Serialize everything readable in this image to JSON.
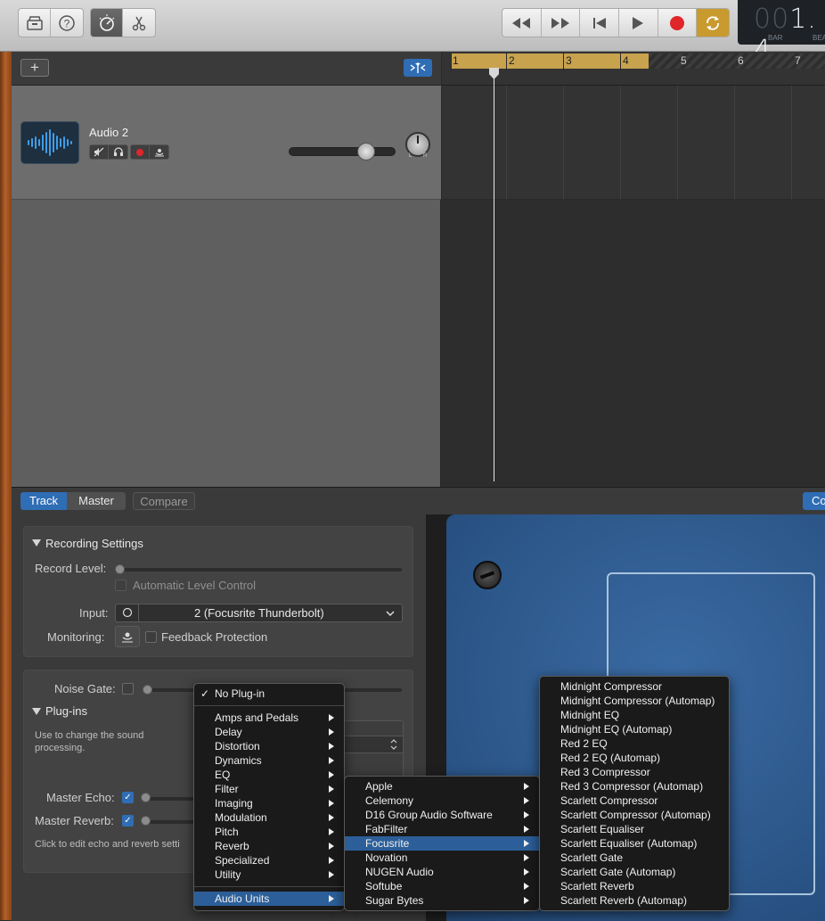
{
  "toolbar": {
    "lcd_digits_dim": "00",
    "lcd_digits": "1. 4",
    "lcd_unit_bar": "BAR",
    "lcd_unit_beat": "BEA"
  },
  "tracks": {
    "track_name": "Audio 2",
    "pan_left": "L",
    "pan_right": "R"
  },
  "ruler": {
    "bars": [
      "1",
      "2",
      "3",
      "4",
      "5",
      "6",
      "7"
    ]
  },
  "editor": {
    "tabs": {
      "track": "Track",
      "master": "Master",
      "compare": "Compare",
      "co": "Co"
    },
    "recording": {
      "title": "Recording Settings",
      "record_level_label": "Record Level:",
      "auto_level_label": "Automatic Level Control",
      "input_label": "Input:",
      "input_value": "2  (Focusrite Thunderbolt)",
      "monitoring_label": "Monitoring:",
      "feedback_label": "Feedback Protection"
    },
    "plugins": {
      "noise_gate_label": "Noise Gate:",
      "title": "Plug-ins",
      "help": "Use to change the sound processing.",
      "master_echo_label": "Master Echo:",
      "master_reverb_label": "Master Reverb:",
      "echo_help": "Click to edit echo and reverb setti"
    }
  },
  "menus": {
    "main": {
      "no_plugin": "No Plug-in",
      "categories": [
        "Amps and Pedals",
        "Delay",
        "Distortion",
        "Dynamics",
        "EQ",
        "Filter",
        "Imaging",
        "Modulation",
        "Pitch",
        "Reverb",
        "Specialized",
        "Utility"
      ],
      "audio_units": "Audio Units"
    },
    "manufacturers": [
      "Apple",
      "Celemony",
      "D16 Group Audio Software",
      "FabFilter",
      "Focusrite",
      "Novation",
      "NUGEN Audio",
      "Softube",
      "Sugar Bytes"
    ],
    "selected_manufacturer": "Focusrite",
    "focusrite_plugins": [
      "Midnight Compressor",
      "Midnight Compressor (Automap)",
      "Midnight EQ",
      "Midnight EQ (Automap)",
      "Red 2 EQ",
      "Red 2 EQ (Automap)",
      "Red 3 Compressor",
      "Red 3 Compressor (Automap)",
      "Scarlett Compressor",
      "Scarlett Compressor (Automap)",
      "Scarlett Equaliser",
      "Scarlett Equaliser (Automap)",
      "Scarlett Gate",
      "Scarlett Gate (Automap)",
      "Scarlett Reverb",
      "Scarlett Reverb (Automap)"
    ]
  },
  "colors": {
    "accent": "#2f6db5",
    "cycle": "#c9a24e",
    "record": "#e0262b",
    "plugin_panel": "#2f5d94"
  }
}
